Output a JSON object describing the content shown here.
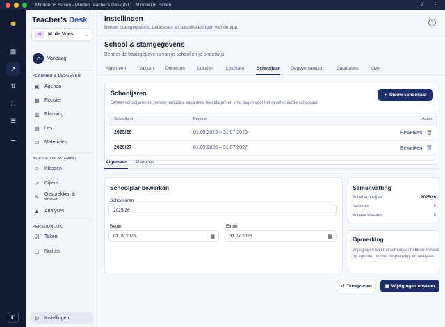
{
  "window": {
    "title": "MindooDB Haven - Mindoo Teacher's Desk (NL) - MindooDB Haven",
    "colors": {
      "close": "#ff5f57",
      "minimize": "#febc2e",
      "maximize": "#28c840"
    }
  },
  "brand": {
    "part1": "Teacher's ",
    "part2": "Desk"
  },
  "user": {
    "initials": "MD",
    "name": "M. de Vries"
  },
  "sidebar": {
    "today": "Vandaag",
    "section1": "PLANNEN & LESGEVEN",
    "section1_items": [
      "Agenda",
      "Rooster",
      "Planning",
      "Les",
      "Materialen"
    ],
    "section2": "KLAS & VOORTGANG",
    "section2_items": [
      "Klassen",
      "Cijfers",
      "Gesprekken & versla...",
      "Analyses"
    ],
    "section3": "PERSOONLIJK",
    "section3_items": [
      "Taken",
      "Notities"
    ],
    "settings": "Instellingen"
  },
  "header": {
    "title": "Instellingen",
    "subtitle": "Beheer stamgegevens, databases en basisinstellingen van de app."
  },
  "section": {
    "title": "School & stamgegevens",
    "subtitle": "Beheer de basisgegevens van je school en je onderwijs."
  },
  "tabs": [
    "Algemeen",
    "Vakken",
    "Docenten",
    "Lokalen",
    "Lestijden",
    "Schooljaar",
    "Gegevensexport",
    "Databases",
    "Over"
  ],
  "active_tab": "Schooljaar",
  "schooljaren": {
    "title": "Schooljaren",
    "subtitle": "Beheer schooljaren en beheer periodes, vakanties, feestdagen en vrije dagen voor het geselecteerde schooljaar.",
    "new_button": "Nieuw schooljaar",
    "columns": [
      "Schooljaren",
      "Periode",
      "Acties"
    ],
    "rows": [
      {
        "year": "2025/26",
        "period": "01.09.2025 – 31.07.2026",
        "action": "Bewerken"
      },
      {
        "year": "2026/27",
        "period": "01.09.2026 – 31.07.2027",
        "action": "Bewerken"
      }
    ]
  },
  "subtabs": [
    "Algemeen",
    "Periodes"
  ],
  "edit_form": {
    "title": "Schooljaar bewerken",
    "year_label": "Schooljaren",
    "year_value": "2025/26",
    "begin_label": "Begin",
    "begin_value": "01.09.2025",
    "end_label": "Einde",
    "end_value": "31.07.2026"
  },
  "summary": {
    "title": "Samenvatting",
    "rows": [
      {
        "label": "Actief schooljaar",
        "value": "2025/26"
      },
      {
        "label": "Periodes",
        "value": "2"
      },
      {
        "label": "Actieve klassen",
        "value": "2"
      }
    ]
  },
  "remark": {
    "title": "Opmerking",
    "text": "Wijzigingen aan het schooljaar hebben invloed op agenda, rooster, lesplanning en analyses"
  },
  "actions": {
    "reset": "Terugzetten",
    "save": "Wijzigingen opslaan"
  }
}
